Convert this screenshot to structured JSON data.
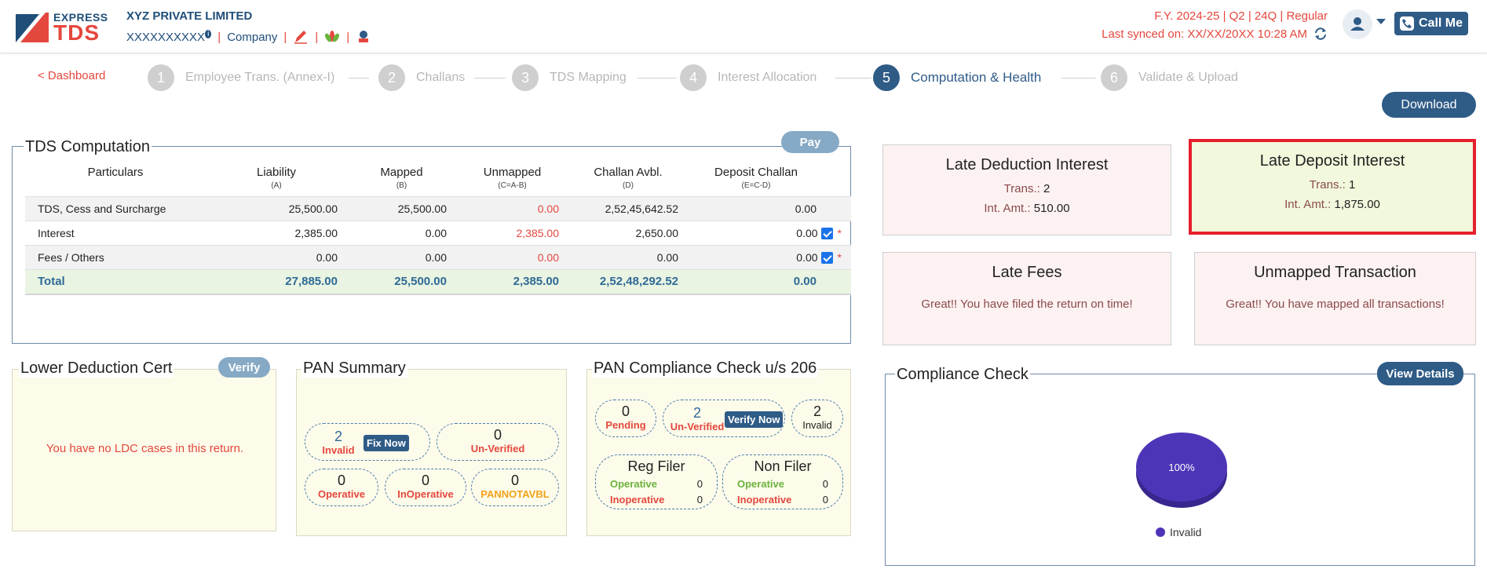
{
  "header": {
    "logo_express": "EXPRESS",
    "logo_tds": "TDS",
    "company_name": "XYZ PRIVATE LIMITED",
    "tan": "XXXXXXXXXX",
    "tan_info": "i",
    "company_link": "Company",
    "separator": "|",
    "fy_info": "F.Y. 2024-25  | Q2  | 24Q | Regular",
    "last_synced": "Last synced on: XX/XX/20XX 10:28 AM",
    "call_label": "Call Me"
  },
  "steps": {
    "back_label": "< Dashboard",
    "items": [
      {
        "num": "1",
        "label": "Employee Trans. (Annex-I)"
      },
      {
        "num": "2",
        "label": "Challans"
      },
      {
        "num": "3",
        "label": "TDS Mapping"
      },
      {
        "num": "4",
        "label": "Interest Allocation"
      },
      {
        "num": "5",
        "label": "Computation & Health"
      },
      {
        "num": "6",
        "label": "Validate & Upload"
      }
    ],
    "active_index": 4,
    "download_label": "Download"
  },
  "tds": {
    "title": "TDS Computation",
    "pay_label": "Pay",
    "columns": [
      {
        "label": "Particulars",
        "sub": ""
      },
      {
        "label": "Liability",
        "sub": "(A)"
      },
      {
        "label": "Mapped",
        "sub": "(B)"
      },
      {
        "label": "Unmapped",
        "sub": "(C=A-B)"
      },
      {
        "label": "Challan Avbl.",
        "sub": "(D)"
      },
      {
        "label": "Deposit Challan",
        "sub": "(E=C-D)"
      }
    ],
    "rows": [
      {
        "particular": "TDS, Cess and Surcharge",
        "liability": "25,500.00",
        "mapped": "25,500.00",
        "unmapped": "0.00",
        "challan": "2,52,45,642.52",
        "deposit": "0.00"
      },
      {
        "particular": "Interest",
        "liability": "2,385.00",
        "mapped": "0.00",
        "unmapped": "2,385.00",
        "challan": "2,650.00",
        "deposit": "0.00"
      },
      {
        "particular": "Fees / Others",
        "liability": "0.00",
        "mapped": "0.00",
        "unmapped": "0.00",
        "challan": "0.00",
        "deposit": "0.00"
      }
    ],
    "total": {
      "particular": "Total",
      "liability": "27,885.00",
      "mapped": "25,500.00",
      "unmapped": "2,385.00",
      "challan": "2,52,48,292.52",
      "deposit": "0.00"
    },
    "required_mark": "*"
  },
  "cards": {
    "late_deduction": {
      "title": "Late Deduction Interest",
      "trans_label": "Trans.:",
      "trans_value": "2",
      "amt_label": "Int. Amt.:",
      "amt_value": "510.00"
    },
    "late_deposit": {
      "title": "Late Deposit Interest",
      "trans_label": "Trans.:",
      "trans_value": "1",
      "amt_label": "Int. Amt.:",
      "amt_value": "1,875.00"
    },
    "late_fees": {
      "title": "Late Fees",
      "message": "Great!! You have filed the return on time!"
    },
    "unmapped": {
      "title": "Unmapped Transaction",
      "message": "Great!! You have mapped all transactions!"
    }
  },
  "ldc": {
    "title": "Lower Deduction Cert",
    "verify_label": "Verify",
    "message": "You have no LDC cases in this return."
  },
  "pan_summary": {
    "title": "PAN Summary",
    "invalid": {
      "count": "2",
      "label": "Invalid",
      "action": "Fix Now"
    },
    "unverified": {
      "count": "0",
      "label": "Un-Verified"
    },
    "operative": {
      "count": "0",
      "label": "Operative"
    },
    "inoperative": {
      "count": "0",
      "label": "InOperative"
    },
    "pannotavbl": {
      "count": "0",
      "label": "PANNOTAVBL"
    }
  },
  "pan_compliance": {
    "title": "PAN Compliance Check u/s 206",
    "pending": {
      "count": "0",
      "label": "Pending"
    },
    "unverified": {
      "count": "2",
      "label": "Un-Verified",
      "action": "Verify Now"
    },
    "invalid": {
      "count": "2",
      "label": "Invalid"
    },
    "reg_filer": {
      "title": "Reg Filer",
      "operative_label": "Operative",
      "operative_value": "0",
      "inoperative_label": "Inoperative",
      "inoperative_value": "0"
    },
    "non_filer": {
      "title": "Non Filer",
      "operative_label": "Operative",
      "operative_value": "0",
      "inoperative_label": "Inoperative",
      "inoperative_value": "0"
    }
  },
  "compliance": {
    "title": "Compliance Check",
    "view_label": "View Details",
    "pie_label": "100%",
    "legend_label": "Invalid",
    "pie_color": "#4e35b8"
  },
  "colors": {
    "brand_blue": "#2f5b87",
    "brand_red": "#e4473d",
    "highlight_border": "#e5202e"
  }
}
